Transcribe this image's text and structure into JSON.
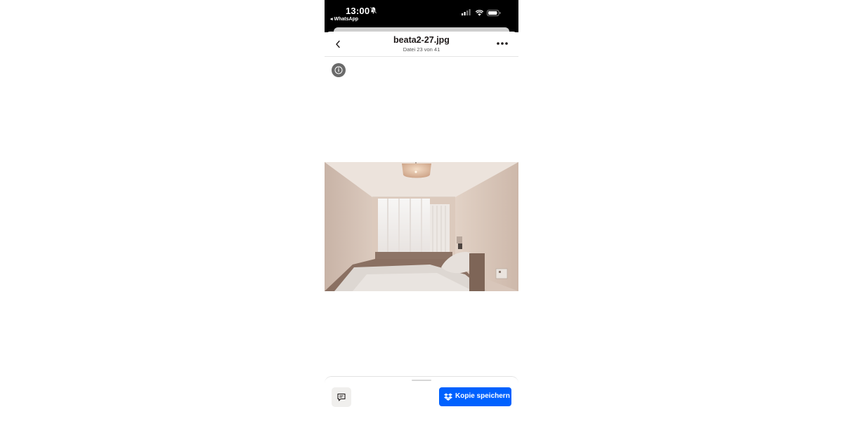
{
  "status_bar": {
    "time": "13:00",
    "back_app": "◂ WhatsApp"
  },
  "header": {
    "title": "beata2-27.jpg",
    "subtitle": "Datei 23 von 41"
  },
  "footer": {
    "save_label": "Kopie speichern"
  },
  "colors": {
    "accent": "#0061fe",
    "status_bar_bg": "#000000",
    "info_button": "#6a6a6a"
  },
  "icons": [
    "bell-slash-icon",
    "cellular-signal-icon",
    "wifi-icon",
    "battery-icon",
    "chevron-left-icon",
    "more-icon",
    "info-icon",
    "comment-icon",
    "dropbox-icon"
  ]
}
